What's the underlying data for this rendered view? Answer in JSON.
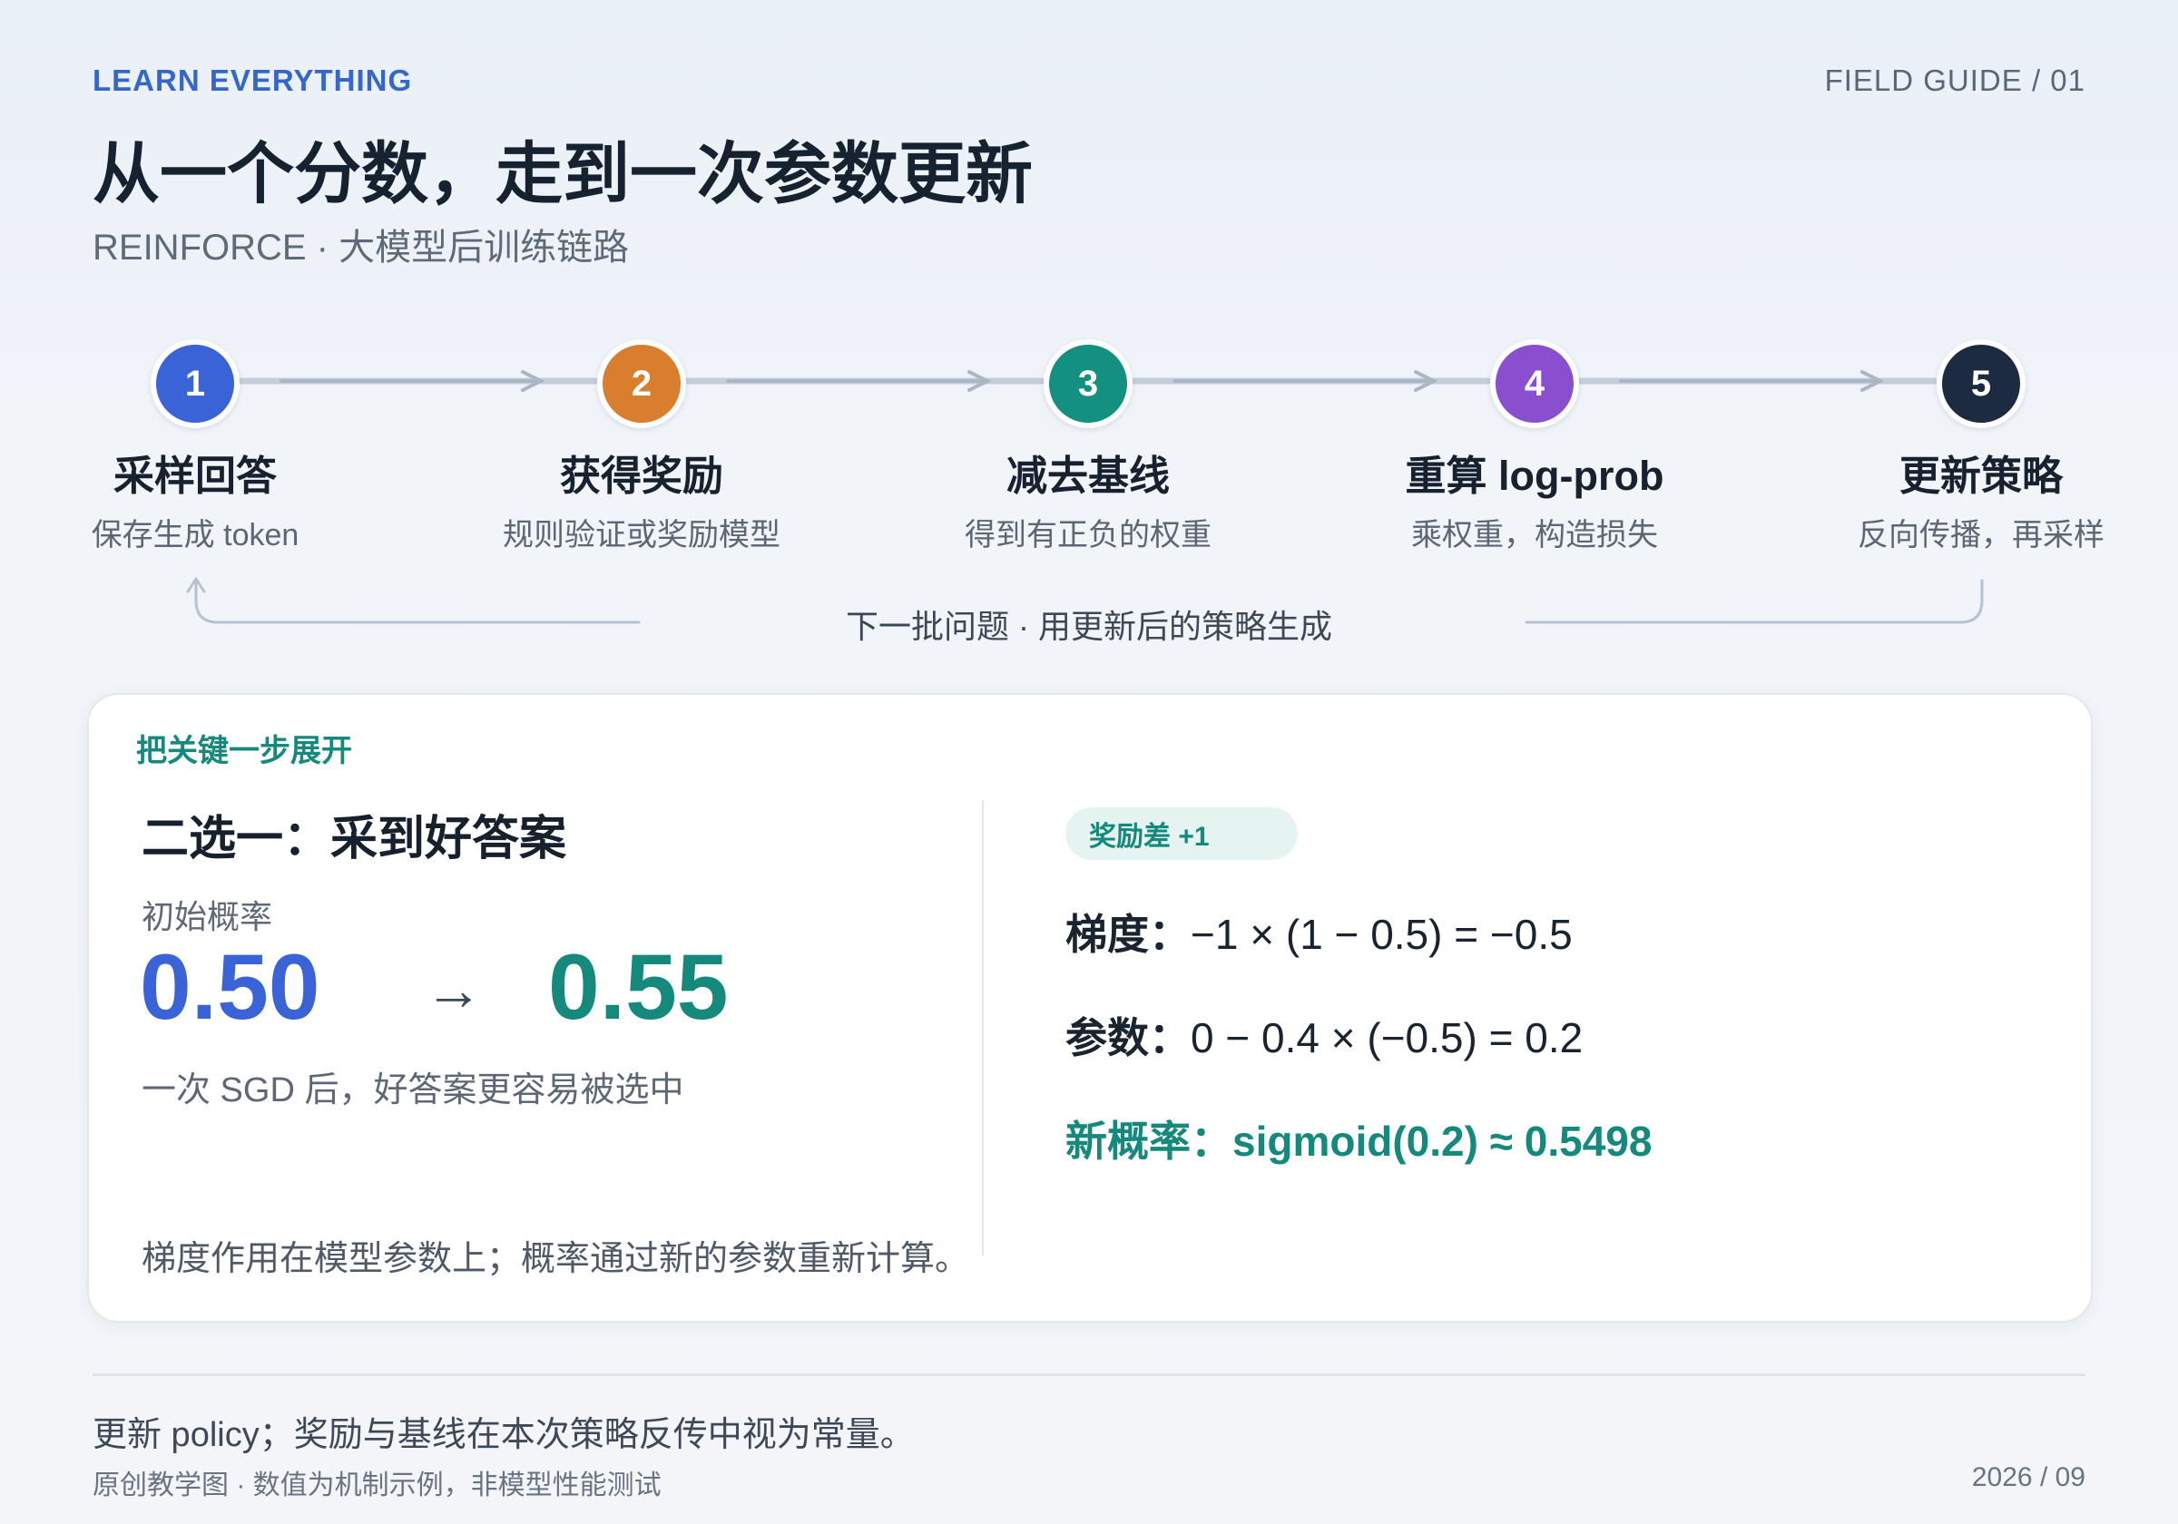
{
  "header": {
    "kicker": "LEARN EVERYTHING",
    "guide": "FIELD GUIDE / 01",
    "title": "从一个分数，走到一次参数更新",
    "subtitle": "REINFORCE · 大模型后训练链路"
  },
  "steps": [
    {
      "num": "1",
      "title": "采样回答",
      "desc": "保存生成 token",
      "color": "#3a63d8"
    },
    {
      "num": "2",
      "title": "获得奖励",
      "desc": "规则验证或奖励模型",
      "color": "#d97d2e"
    },
    {
      "num": "3",
      "title": "减去基线",
      "desc": "得到有正负的权重",
      "color": "#139080"
    },
    {
      "num": "4",
      "title": "重算 log-prob",
      "desc": "乘权重，构造损失",
      "color": "#8a4fcf"
    },
    {
      "num": "5",
      "title": "更新策略",
      "desc": "反向传播，再采样",
      "color": "#1c2a42"
    }
  ],
  "loop_label": "下一批问题 · 用更新后的策略生成",
  "card": {
    "kicker": "把关键一步展开",
    "heading": "二选一：采到好答案",
    "init_label": "初始概率",
    "prob_before": "0.50",
    "arrow": "→",
    "prob_after": "0.55",
    "note": "一次 SGD 后，好答案更容易被选中",
    "bottom_note": "梯度作用在模型参数上；概率通过新的参数重新计算。",
    "pill": "奖励差 +1",
    "eq1_label": "梯度：",
    "eq1": "−1 × (1 − 0.5) = −0.5",
    "eq2_label": "参数：",
    "eq2": "0 − 0.4 × (−0.5) = 0.2",
    "eq3_label": "新概率：",
    "eq3": "sigmoid(0.2) ≈ 0.5498",
    "color_before": "#3a63d8",
    "color_after": "#14897c"
  },
  "footer": {
    "line1": "更新 policy；奖励与基线在本次策略反传中视为常量。",
    "line2": "原创教学图 · 数值为机制示例，非模型性能测试",
    "date": "2026 / 09"
  }
}
